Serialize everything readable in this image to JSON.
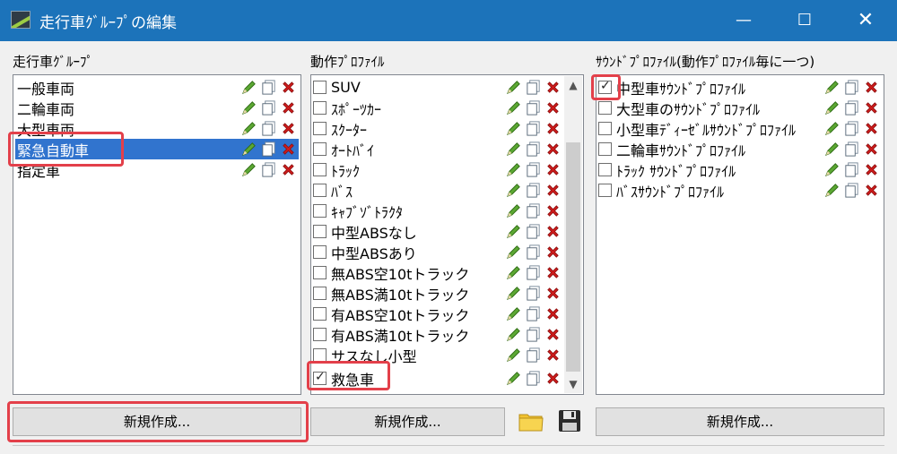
{
  "window": {
    "title": "走行車ｸﾞﾙｰﾌﾟの編集",
    "minimize": "—",
    "maximize": "☐",
    "close": "✕"
  },
  "group_panel": {
    "label": "走行車ｸﾞﾙｰﾌﾟ",
    "items": [
      "一般車両",
      "二輪車両",
      "大型車両",
      "緊急自動車",
      "指定車"
    ],
    "selected_index": 3,
    "new_button": "新規作成..."
  },
  "motion_panel": {
    "label": "動作ﾌﾟﾛﾌｧｲﾙ",
    "items": [
      {
        "label": "SUV",
        "checked": false
      },
      {
        "label": "ｽﾎﾟｰﾂｶｰ",
        "checked": false
      },
      {
        "label": "ｽｸｰﾀｰ",
        "checked": false
      },
      {
        "label": "ｵｰﾄﾊﾞｲ",
        "checked": false
      },
      {
        "label": "ﾄﾗｯｸ",
        "checked": false
      },
      {
        "label": "ﾊﾞｽ",
        "checked": false
      },
      {
        "label": "ｷｬﾌﾞｿﾞﾄﾗｸﾀ",
        "checked": false
      },
      {
        "label": "中型ABSなし",
        "checked": false
      },
      {
        "label": "中型ABSあり",
        "checked": false
      },
      {
        "label": "無ABS空10tトラック",
        "checked": false
      },
      {
        "label": "無ABS満10tトラック",
        "checked": false
      },
      {
        "label": "有ABS空10tトラック",
        "checked": false
      },
      {
        "label": "有ABS満10tトラック",
        "checked": false
      },
      {
        "label": "サスなし小型",
        "checked": false
      },
      {
        "label": "救急車",
        "checked": true
      }
    ],
    "new_button": "新規作成..."
  },
  "sound_panel": {
    "label": "ｻｳﾝﾄﾞﾌﾟﾛﾌｧｲﾙ(動作ﾌﾟﾛﾌｧｲﾙ毎に一つ)",
    "items": [
      {
        "label": "中型車ｻｳﾝﾄﾞﾌﾟﾛﾌｧｲﾙ",
        "checked": true
      },
      {
        "label": "大型車のｻｳﾝﾄﾞﾌﾟﾛﾌｧｲﾙ",
        "checked": false
      },
      {
        "label": "小型車ﾃﾞｨｰｾﾞﾙｻｳﾝﾄﾞﾌﾟﾛﾌｧｲﾙ",
        "checked": false
      },
      {
        "label": "二輪車ｻｳﾝﾄﾞﾌﾟﾛﾌｧｲﾙ",
        "checked": false
      },
      {
        "label": "ﾄﾗｯｸ ｻｳﾝﾄﾞﾌﾟﾛﾌｧｲﾙ",
        "checked": false
      },
      {
        "label": "ﾊﾞｽｻｳﾝﾄﾞﾌﾟﾛﾌｧｲﾙ",
        "checked": false
      }
    ],
    "new_button": "新規作成..."
  },
  "icons": {
    "edit": "pencil-icon",
    "copy": "copy-icon",
    "delete": "delete-x-icon",
    "open": "folder-icon",
    "save": "floppy-disk-icon"
  },
  "colors": {
    "titlebar": "#1c73ba",
    "selection": "#3174ce",
    "highlight": "#e3404a",
    "pencil": "#5ca833",
    "delete": "#cc1b1b",
    "folder": "#f2c230"
  }
}
